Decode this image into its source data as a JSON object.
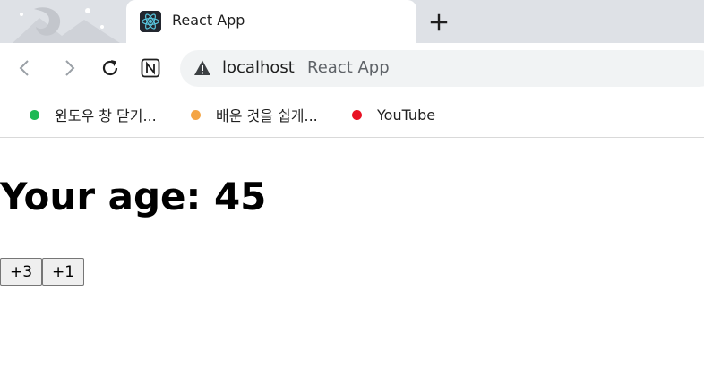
{
  "browser": {
    "tab": {
      "title": "React App",
      "favicon": "react-logo-icon"
    },
    "new_tab_icon": "plus-icon",
    "toolbar": {
      "back_icon": "arrow-left-icon",
      "forward_icon": "arrow-right-icon",
      "reload_icon": "reload-icon",
      "extension_icon": "notion-icon"
    },
    "omnibox": {
      "security_icon": "warning-triangle-icon",
      "host": "localhost",
      "page_title": "React App"
    },
    "bookmarks": [
      {
        "label": "윈도우 창 닫기...",
        "color": "#1db954"
      },
      {
        "label": "배운 것을 쉽게...",
        "color": "#f4a443"
      },
      {
        "label": "YouTube",
        "color": "#e81123"
      }
    ]
  },
  "page": {
    "heading": "Your age: 45",
    "buttons": [
      {
        "label": "+3"
      },
      {
        "label": "+1"
      }
    ]
  },
  "colors": {
    "tabstrip_bg": "#dee1e6",
    "omnibox_bg": "#f1f3f4",
    "react_cyan": "#58c4dc"
  }
}
